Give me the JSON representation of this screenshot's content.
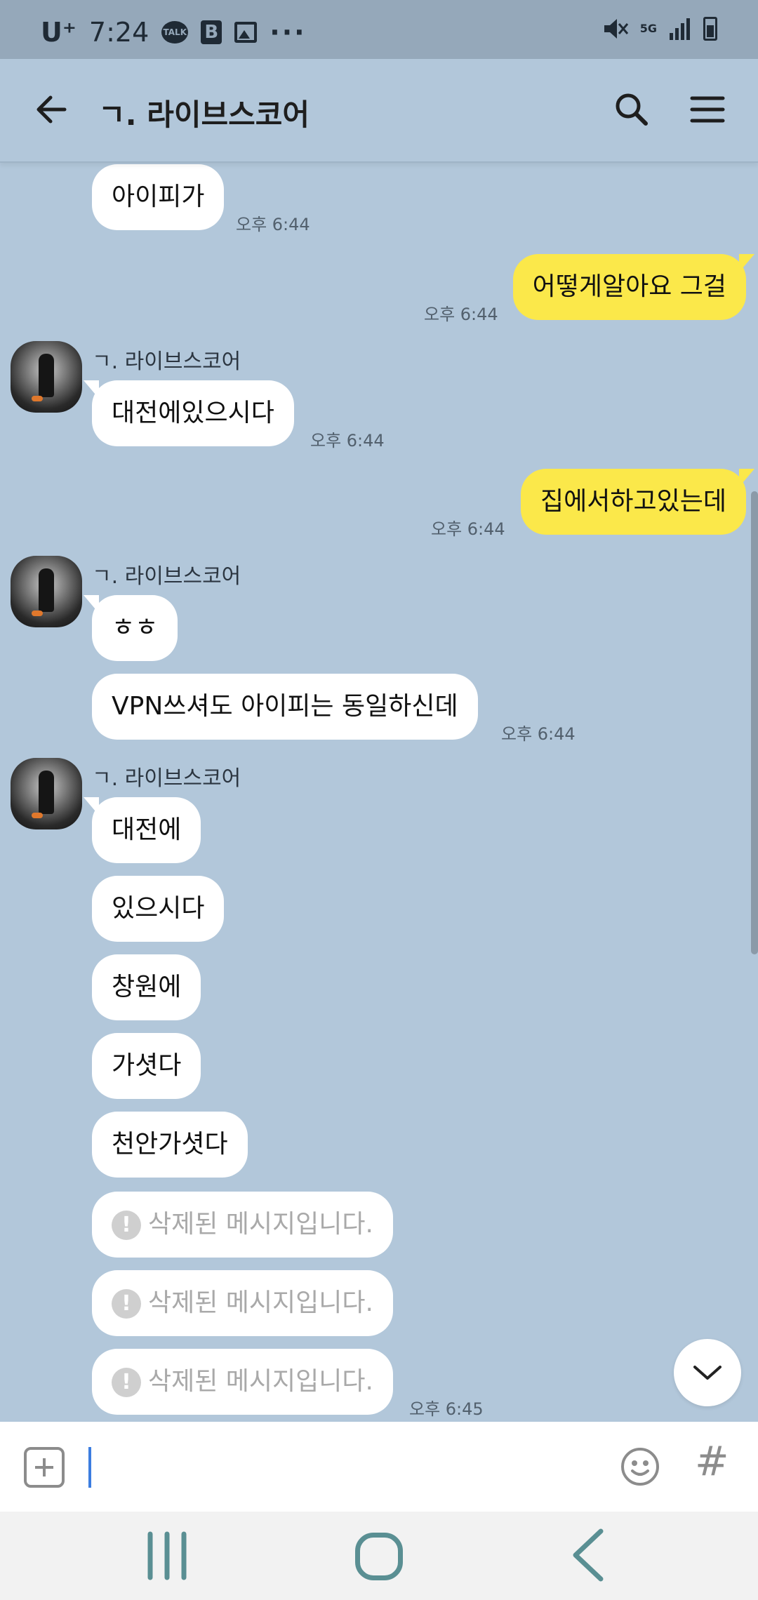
{
  "status_bar": {
    "carrier": "U⁺",
    "time": "7:24",
    "talk_badge": "TALK",
    "b_badge": "B",
    "more_dots": "···",
    "network": "5G"
  },
  "header": {
    "title": "ㄱ. 라이브스코어"
  },
  "messages": [
    {
      "text": "아이피가",
      "time": "오후 6:44"
    },
    {
      "text": "어떻게알아요 그걸",
      "time": "오후 6:44"
    },
    {
      "sender": "ㄱ. 라이브스코어",
      "text": "대전에있으시다",
      "time": "오후 6:44"
    },
    {
      "text": "집에서하고있는데",
      "time": "오후 6:44"
    },
    {
      "sender": "ㄱ. 라이브스코어",
      "text": "ㅎㅎ"
    },
    {
      "text": "VPN쓰셔도 아이피는 동일하신데",
      "time": "오후 6:44"
    },
    {
      "sender": "ㄱ. 라이브스코어",
      "text": "대전에"
    },
    {
      "text": "있으시다"
    },
    {
      "text": "창원에"
    },
    {
      "text": "가셧다"
    },
    {
      "text": "천안가셧다"
    },
    {
      "text": "삭제된 메시지입니다."
    },
    {
      "text": "삭제된 메시지입니다."
    },
    {
      "text": "삭제된 메시지입니다.",
      "time": "오후 6:45"
    }
  ],
  "input": {
    "value": "",
    "hash_label": "#"
  },
  "colors": {
    "chat_background": "#b2c7da",
    "my_bubble": "#fbe84a",
    "their_bubble": "#ffffff",
    "status_bar": "#95a8ba",
    "nav_icon": "#5a8f93"
  }
}
